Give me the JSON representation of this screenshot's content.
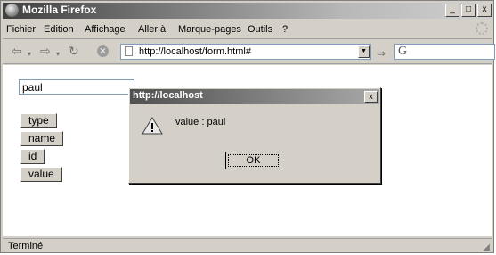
{
  "window": {
    "title": "Mozilla Firefox",
    "controls": [
      "_",
      "□",
      "x"
    ]
  },
  "menu": [
    "Fichier",
    "Edition",
    "Affichage",
    "Aller à",
    "Marque-pages",
    "Outils",
    "?"
  ],
  "navbar": {
    "url": "http://localhost/form.html#",
    "search_value": ""
  },
  "form": {
    "text_value": "paul",
    "buttons": [
      "type",
      "name",
      "id",
      "value"
    ]
  },
  "status": "Terminé",
  "dialog": {
    "title": "http://localhost",
    "close": "x",
    "message": "value : paul",
    "ok": "OK"
  }
}
